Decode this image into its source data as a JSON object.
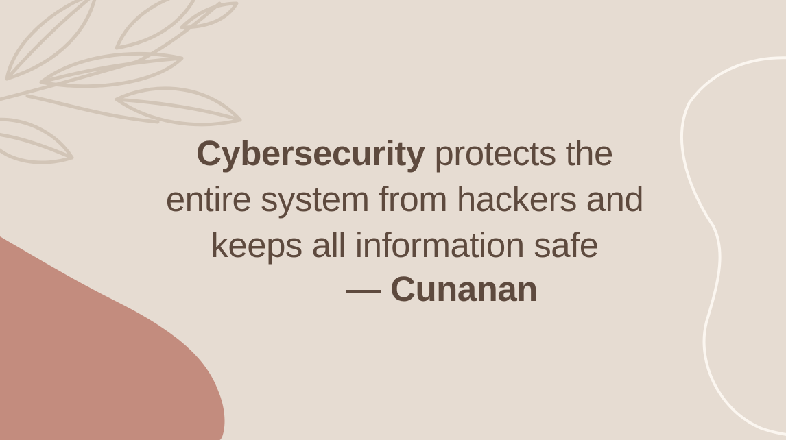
{
  "colors": {
    "background": "#E6DCD2",
    "blob": "#C38C7E",
    "leaf_stroke": "#D2C5B7",
    "outline_stroke": "#FBF6F0",
    "text": "#5E4A3E"
  },
  "quote": {
    "highlight": "Cybersecurity",
    "line1_rest": " protects the",
    "line2": "entire system from hackers and",
    "line3": "keeps all information safe"
  },
  "author": "— Cunanan",
  "decorations": {
    "leaf_icon": "leaf-sprig-icon",
    "blob_icon": "organic-blob-shape",
    "outline_icon": "organic-outline-shape"
  }
}
